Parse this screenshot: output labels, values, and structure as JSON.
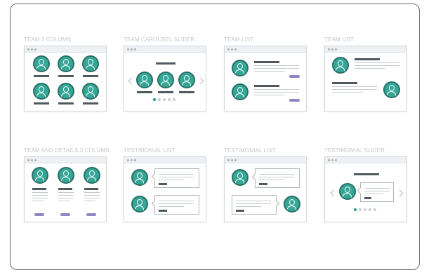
{
  "templates": [
    {
      "label": "TEAM 3 COLUMN"
    },
    {
      "label": "TEAM CAROUSEL SLIDER"
    },
    {
      "label": "TEAM LIST"
    },
    {
      "label": "TEAM LIST"
    },
    {
      "label": "TEAM AND DETAILS 3 COLUMN"
    },
    {
      "label": "TESTIMONIAL LIST"
    },
    {
      "label": "TESTIMONIAL LIST"
    },
    {
      "label": "TESTIMONIAL SLIDER"
    }
  ],
  "colors": {
    "accent_teal": "#34a797",
    "avatar_ring": "#2b6f66",
    "button_purple": "#8f86c4",
    "heading_dark": "#4f5a60",
    "label_gray": "#c4c8cb"
  },
  "icons": {
    "avatar": "user-avatar-icon",
    "prev": "chevron-left-icon",
    "next": "chevron-right-icon"
  }
}
